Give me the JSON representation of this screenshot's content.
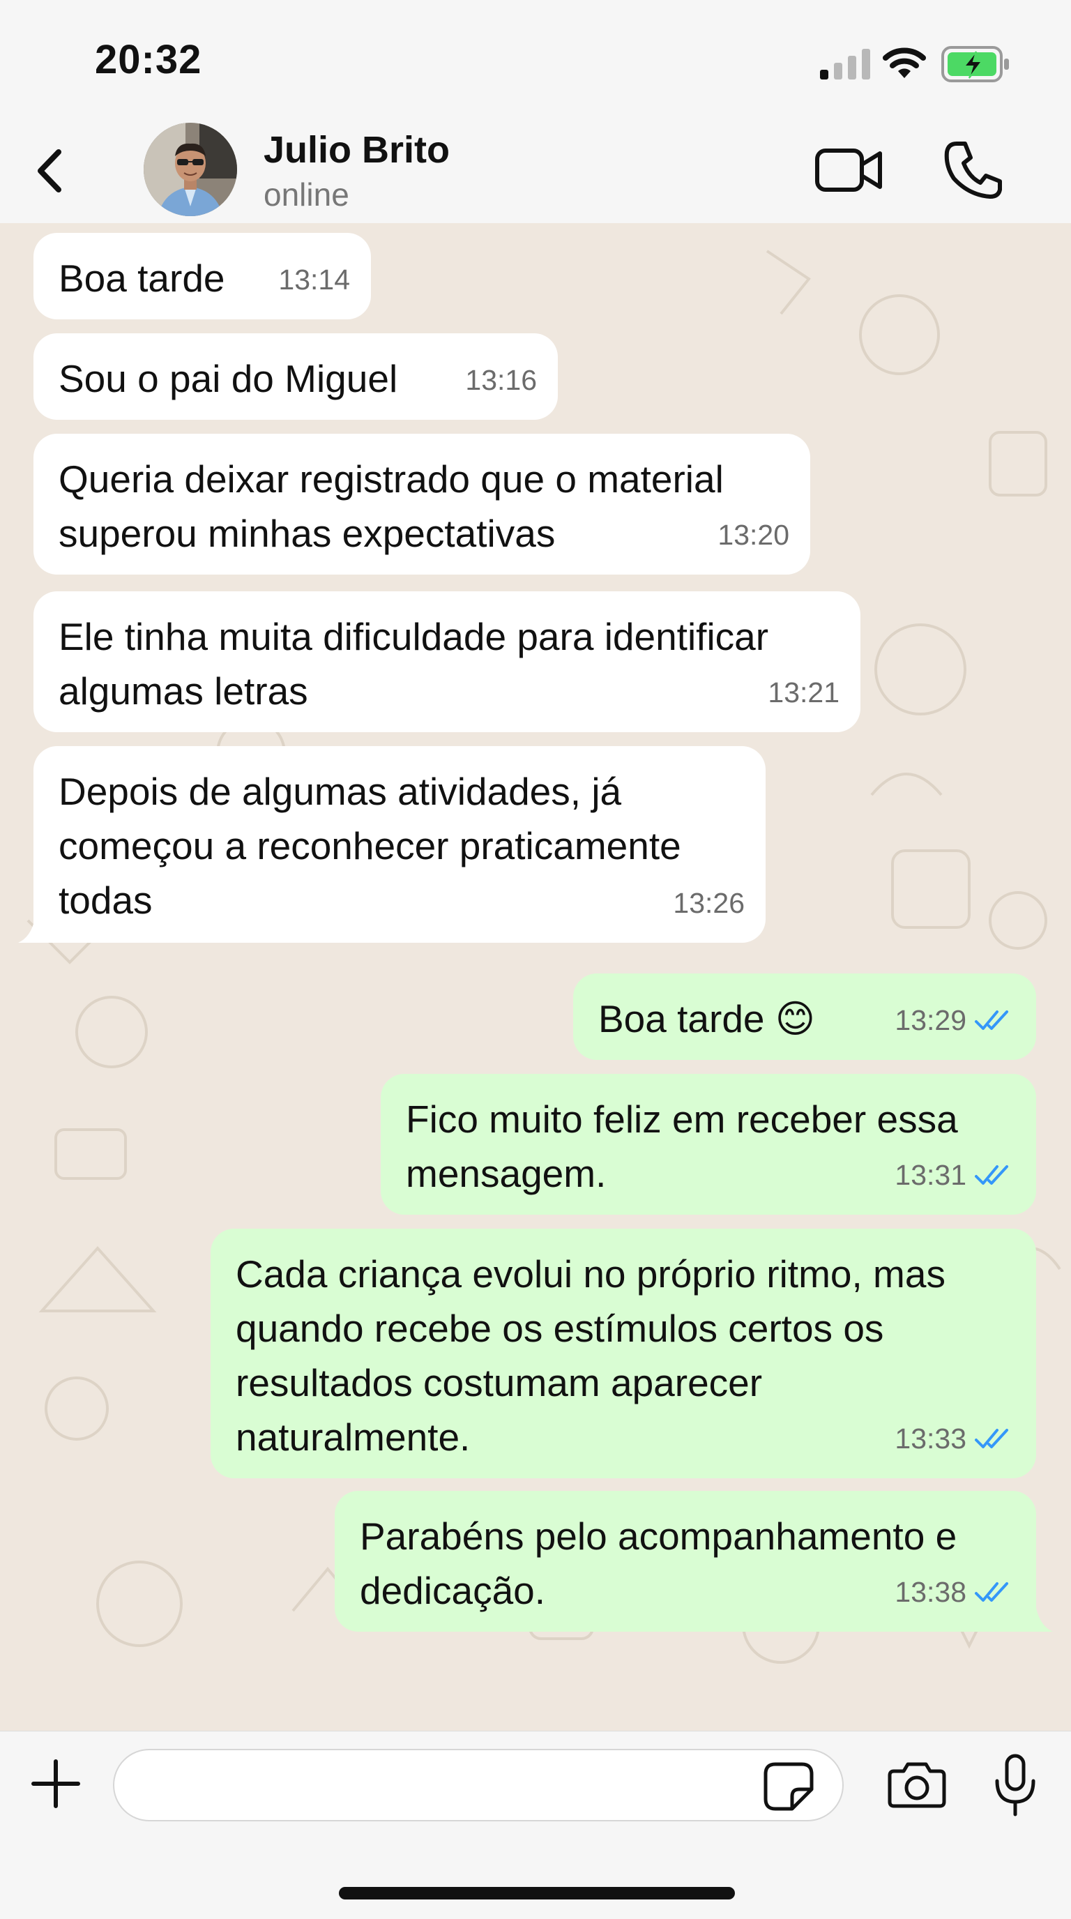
{
  "status_bar": {
    "time": "20:32",
    "icons": [
      "signal-icon",
      "wifi-icon",
      "battery-charging-icon"
    ]
  },
  "header": {
    "contact_name": "Julio Brito",
    "contact_status": "online",
    "icons": [
      "back-chevron-icon",
      "avatar-photo",
      "video-call-icon",
      "phone-call-icon"
    ]
  },
  "messages": [
    {
      "direction": "incoming",
      "text": "Boa tarde",
      "time": "13:14"
    },
    {
      "direction": "incoming",
      "text": "Sou o pai do Miguel",
      "time": "13:16"
    },
    {
      "direction": "incoming",
      "lines": [
        "Queria deixar registrado que o material",
        "superou minhas expectativas"
      ],
      "time": "13:20"
    },
    {
      "direction": "incoming",
      "lines": [
        "Ele tinha muita dificuldade para identificar",
        "algumas letras"
      ],
      "time": "13:21"
    },
    {
      "direction": "incoming",
      "lines": [
        "Depois de algumas atividades, já",
        "começou a reconhecer praticamente",
        "todas"
      ],
      "time": "13:26"
    },
    {
      "direction": "outgoing",
      "text": "Boa tarde 😊",
      "time": "13:29",
      "status": "read"
    },
    {
      "direction": "outgoing",
      "lines": [
        "Fico muito feliz em receber essa",
        "mensagem."
      ],
      "time": "13:31",
      "status": "read"
    },
    {
      "direction": "outgoing",
      "lines": [
        "Cada criança evolui no próprio ritmo, mas",
        "quando recebe os estímulos certos os",
        "resultados costumam aparecer",
        "naturalmente."
      ],
      "time": "13:33",
      "status": "read"
    },
    {
      "direction": "outgoing",
      "lines": [
        "Parabéns pelo acompanhamento e",
        "dedicação."
      ],
      "time": "13:38",
      "status": "read"
    }
  ],
  "input_bar": {
    "placeholder": "",
    "icons": [
      "plus-icon",
      "sticker-icon",
      "camera-icon",
      "microphone-icon"
    ]
  },
  "colors": {
    "incoming_bubble": "#ffffff",
    "outgoing_bubble": "#d9fdd3",
    "chat_background": "#efe7de",
    "read_ticks": "#3497f9",
    "battery_charging": "#4cd964"
  }
}
